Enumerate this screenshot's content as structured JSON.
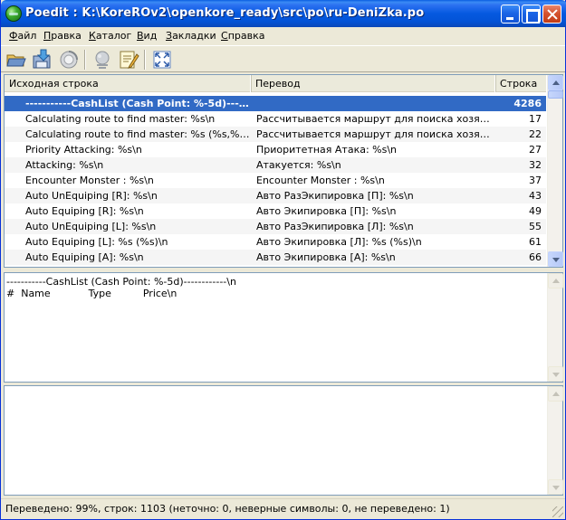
{
  "window": {
    "title": "Poedit : K:\\KoreROv2\\openkore_ready\\src\\po\\ru-DeniZka.po"
  },
  "menu": [
    {
      "label": "Файл",
      "ul": "Ф",
      "rest": "айл"
    },
    {
      "label": "Правка",
      "ul": "П",
      "rest": "равка"
    },
    {
      "label": "Каталог",
      "ul": "К",
      "rest": "аталог"
    },
    {
      "label": "Вид",
      "ul": "В",
      "rest": "ид"
    },
    {
      "label": "Закладки",
      "ul": "З",
      "rest": "акладки"
    },
    {
      "label": "Справка",
      "ul": "С",
      "rest": "правка"
    }
  ],
  "toolbar": {
    "icons": [
      "open-folder-icon",
      "save-icon",
      "update-catalog-icon",
      "validate-icon",
      "edit-comment-icon",
      "fullscreen-icon"
    ]
  },
  "table": {
    "headers": {
      "source": "Исходная строка",
      "translation": "Перевод",
      "line": "Строка"
    },
    "rows": [
      {
        "source": "-----------CashList (Cash Point: %-5d)------...",
        "translation": "",
        "line": "4286",
        "selected": true
      },
      {
        "source": "Calculating route to find master: %s\\n",
        "translation": "Рассчитывается маршрут для поиска хозяина: ...",
        "line": "17"
      },
      {
        "source": "Calculating route to find master: %s (%s,%s)\\n",
        "translation": "Рассчитывается маршрут для поиска хозяина: ...",
        "line": "22"
      },
      {
        "source": "Priority Attacking: %s\\n",
        "translation": "Приоритетная Атака: %s\\n",
        "line": "27"
      },
      {
        "source": "Attacking: %s\\n",
        "translation": "Атакуется: %s\\n",
        "line": "32"
      },
      {
        "source": "Encounter Monster : %s\\n",
        "translation": "Encounter Monster : %s\\n",
        "line": "37"
      },
      {
        "source": "Auto UnEquiping [R]: %s\\n",
        "translation": "Авто РазЭкипировка [П]: %s\\n",
        "line": "43"
      },
      {
        "source": "Auto Equiping [R]: %s\\n",
        "translation": "Авто Экипировка [П]: %s\\n",
        "line": "49"
      },
      {
        "source": "Auto UnEquiping [L]: %s\\n",
        "translation": "Авто РазЭкипировка [Л]: %s\\n",
        "line": "55"
      },
      {
        "source": "Auto Equiping [L]: %s (%s)\\n",
        "translation": "Авто Экипировка [Л]: %s (%s)\\n",
        "line": "61"
      },
      {
        "source": "Auto Equiping [A]: %s\\n",
        "translation": "Авто Экипировка [А]: %s\\n",
        "line": "66"
      }
    ]
  },
  "source_pane": {
    "text": "-----------CashList (Cash Point: %-5d)------------\\n\n#  Name            Type          Price\\n"
  },
  "translation_pane": {
    "text": ""
  },
  "status": {
    "text": "Переведено: 99%, строк: 1103 (неточно: 0, неверные символы: 0, не переведено: 1)"
  },
  "colors": {
    "selection": "#316ac5",
    "titlebar": "#0559e0"
  }
}
